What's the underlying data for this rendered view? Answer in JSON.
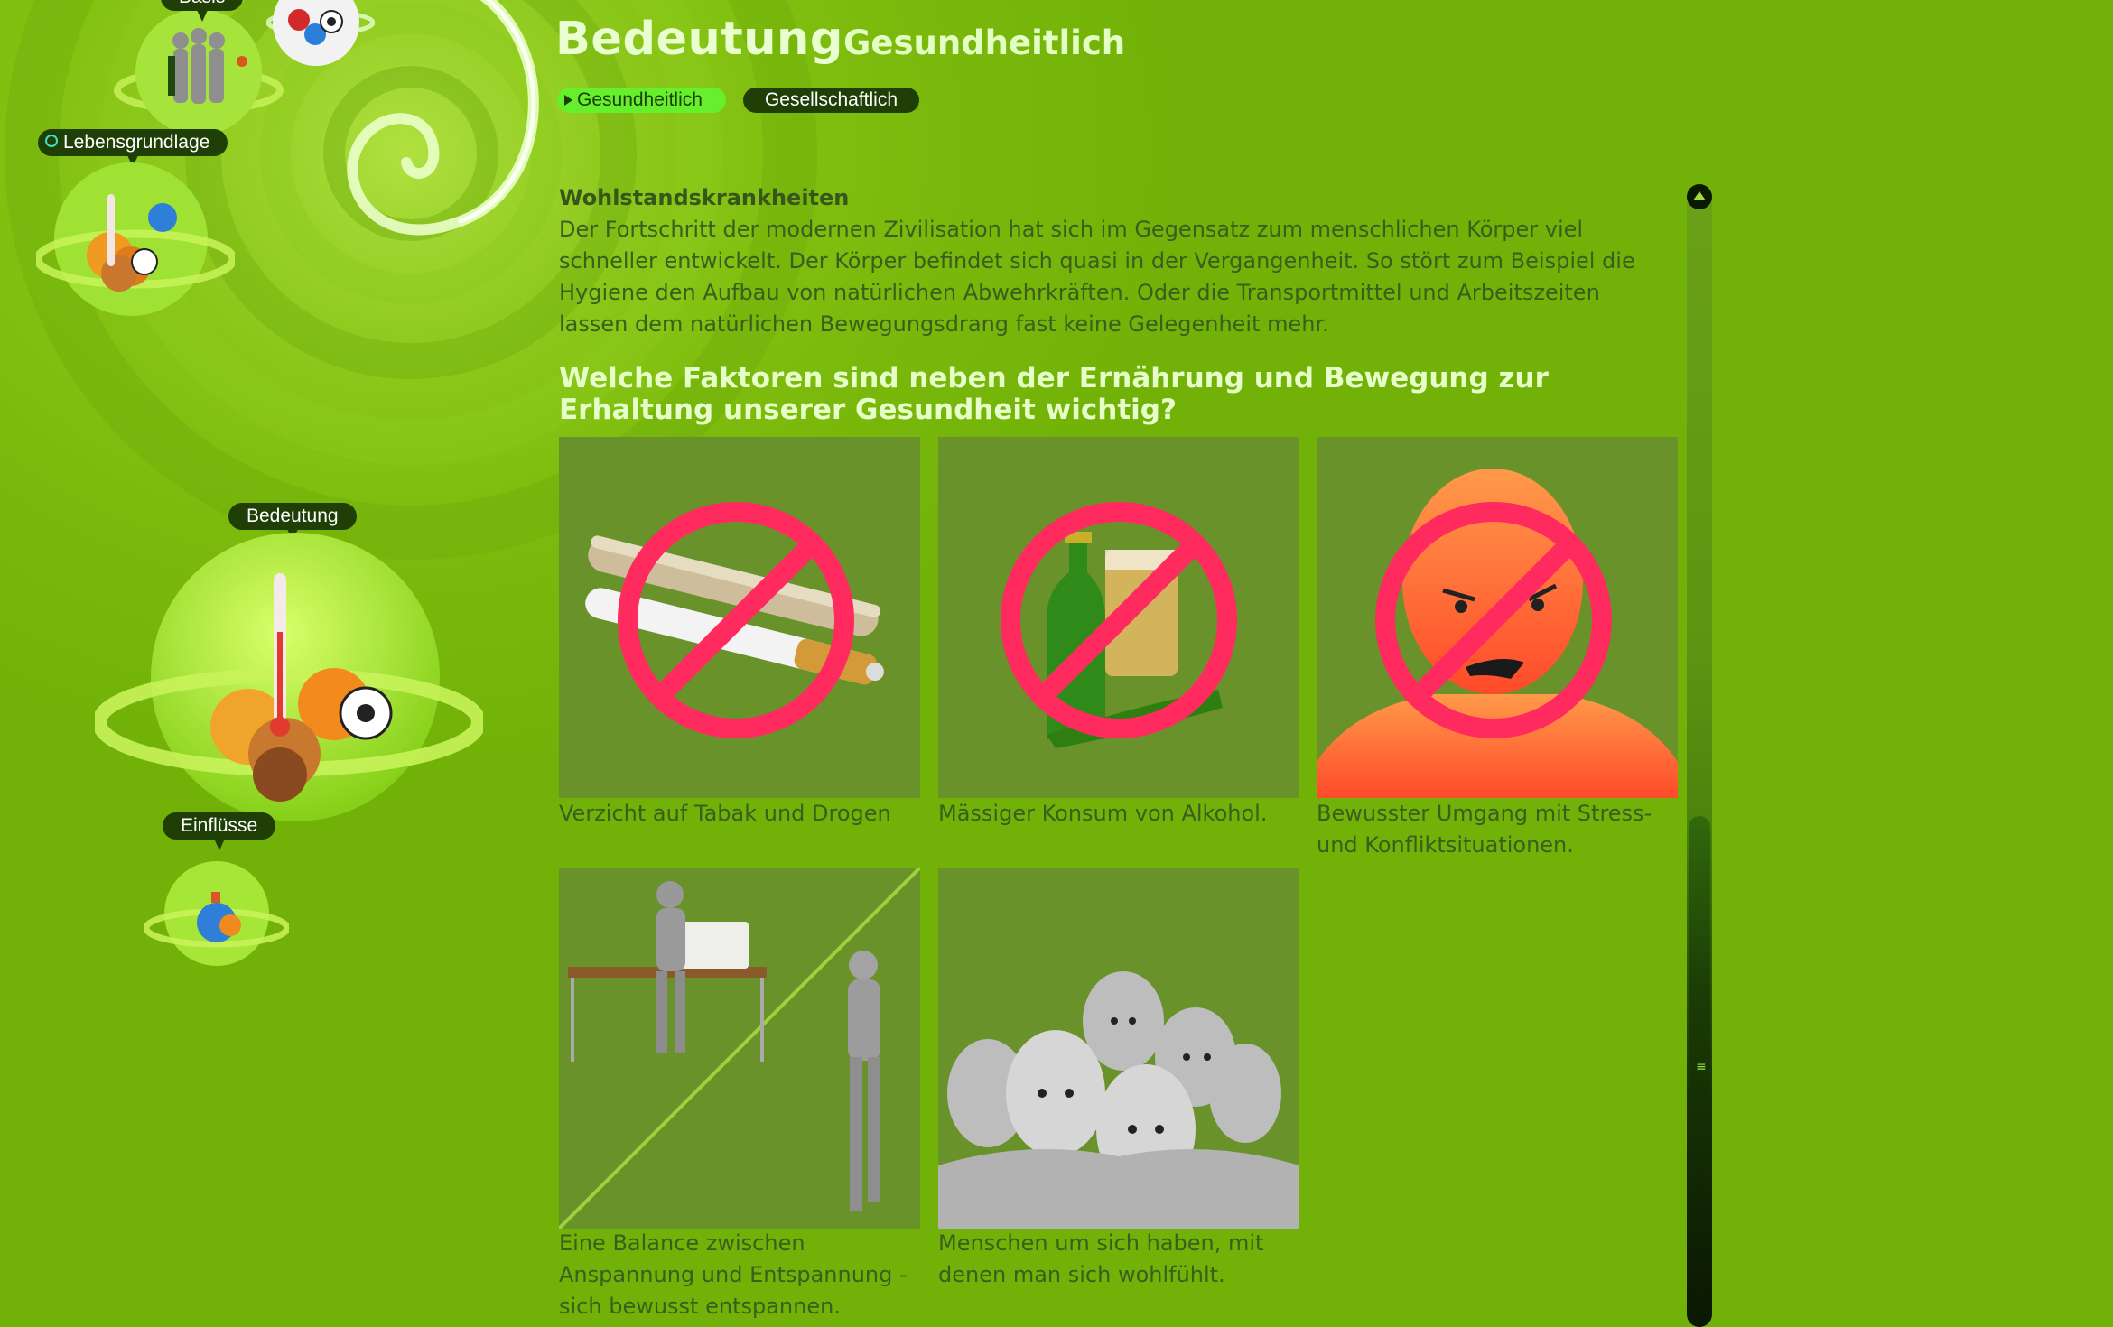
{
  "nav": {
    "basis": "Basis",
    "lebensgrundlage": "Lebensgrundlage",
    "bedeutung": "Bedeutung",
    "einfluesse": "Einflüsse"
  },
  "header": {
    "title": "Bedeutung",
    "subtitle": "Gesundheitlich"
  },
  "tabs": [
    {
      "label": "Gesundheitlich",
      "active": true
    },
    {
      "label": "Gesellschaftlich",
      "active": false
    }
  ],
  "content": {
    "section_heading": "Wohlstandskrankheiten",
    "intro": "Der Fortschritt der modernen Zivilisation hat sich im Gegensatz zum menschlichen Körper viel schneller entwickelt. Der Körper befindet sich quasi in der Vergangenheit. So stört zum Beispiel die Hygiene den Aufbau von natürlichen Abwehrkräften. Oder die Transportmittel und Arbeitszeiten lassen dem natürlichen Bewegungsdrang fast keine Gelegenheit mehr.",
    "question": "Welche Faktoren sind neben der Ernährung und Bewegung zur Erhaltung unserer Gesundheit wichtig?",
    "factors": [
      {
        "caption": "Verzicht auf Tabak und Drogen",
        "icon": "no-smoking-icon"
      },
      {
        "caption": "Mässiger Konsum von Alkohol.",
        "icon": "no-alcohol-icon"
      },
      {
        "caption": "Bewusster Umgang mit Stress- und Konfliktsituationen.",
        "icon": "no-stress-icon"
      },
      {
        "caption": "Eine Balance zwischen Anspannung und Entspannung - sich bewusst entspannen.",
        "icon": "work-life-balance-icon"
      },
      {
        "caption": "Menschen um sich haben, mit denen man sich wohlfühlt.",
        "icon": "social-group-icon"
      }
    ]
  },
  "colors": {
    "background": "#7ab90a",
    "pill": "#1f3f07",
    "active_tab": "#66ef2c",
    "question": "#e6ffc8",
    "prohibition": "#ff2b5e"
  }
}
